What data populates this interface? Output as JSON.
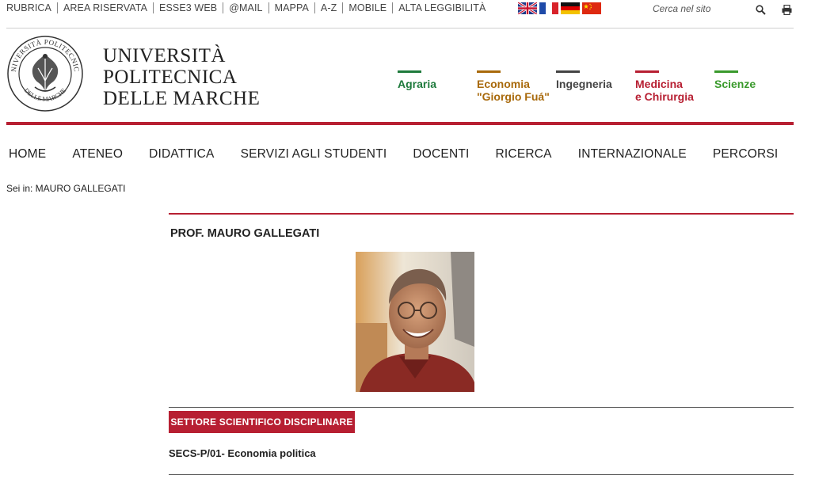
{
  "util_links": [
    "RUBRICA",
    "AREA RISERVATA",
    "ESSE3 WEB",
    "@MAIL",
    "MAPPA",
    "A-Z",
    "MOBILE",
    "ALTA LEGGIBILITÀ"
  ],
  "flags": [
    "uk-flag",
    "france-flag",
    "germany-flag",
    "china-flag"
  ],
  "search": {
    "placeholder": "Cerca nel sito"
  },
  "university": {
    "line1": "UNIVERSITÀ",
    "line2": "POLITECNICA",
    "line3": "DELLE MARCHE"
  },
  "faculties": [
    {
      "line1": "Agraria",
      "line2": "",
      "color": "#1e7a3c"
    },
    {
      "line1": "Economia",
      "line2": "\"Giorgio Fuá\"",
      "color": "#a8690b"
    },
    {
      "line1": "Ingegneria",
      "line2": "",
      "color": "#444444"
    },
    {
      "line1": "Medicina",
      "line2": "e Chirurgia",
      "color": "#b71f32"
    },
    {
      "line1": "Scienze",
      "line2": "",
      "color": "#3a9a2c"
    }
  ],
  "mainnav": [
    "HOME",
    "ATENEO",
    "DIDATTICA",
    "SERVIZI AGLI STUDENTI",
    "DOCENTI",
    "RICERCA",
    "INTERNAZIONALE",
    "PERCORSI"
  ],
  "breadcrumb": "Sei in: MAURO GALLEGATI",
  "profile": {
    "title": "PROF. MAURO GALLEGATI",
    "ssd_label": "SETTORE SCIENTIFICO DISCIPLINARE",
    "ssd_value": "SECS-P/01- Economia politica"
  },
  "colors": {
    "accent": "#b71f32"
  }
}
